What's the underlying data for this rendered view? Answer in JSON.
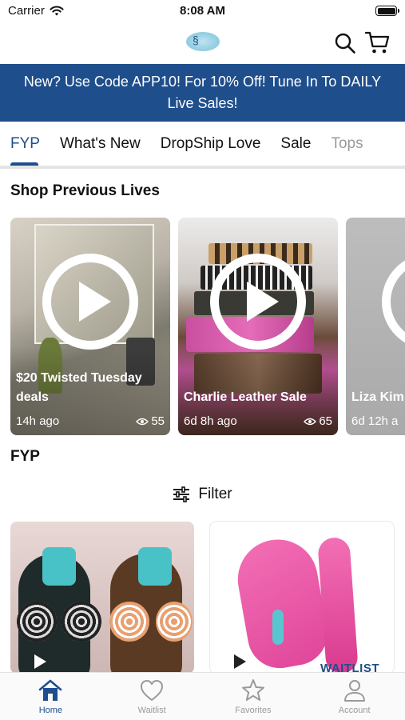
{
  "status_bar": {
    "carrier": "Carrier",
    "time": "8:08 AM"
  },
  "promo": {
    "text": "New? Use Code APP10! For 10% Off! Tune In To DAILY Live Sales!"
  },
  "tabs": [
    {
      "label": "FYP"
    },
    {
      "label": "What's New"
    },
    {
      "label": "DropShip Love"
    },
    {
      "label": "Sale"
    },
    {
      "label": "Tops"
    }
  ],
  "sections": {
    "previous_lives": "Shop Previous Lives",
    "fyp": "FYP"
  },
  "lives": [
    {
      "title": "$20 Twisted Tuesday deals",
      "time": "14h ago",
      "views": "55"
    },
    {
      "title": "Charlie Leather Sale",
      "time": "6d 8h ago",
      "views": "65"
    },
    {
      "title": "Liza Kim",
      "time": "6d 12h a",
      "views": ""
    }
  ],
  "filter": {
    "label": "Filter"
  },
  "products": [
    {
      "tag": ""
    },
    {
      "tag": "WAITLIST"
    }
  ],
  "bottom_nav": [
    {
      "label": "Home",
      "icon": "home-icon"
    },
    {
      "label": "Waitlist",
      "icon": "heart-icon"
    },
    {
      "label": "Favorites",
      "icon": "star-icon"
    },
    {
      "label": "Account",
      "icon": "person-icon"
    }
  ],
  "colors": {
    "brand": "#1f4e8c",
    "inactive": "#9a9a9a",
    "banner_text": "#ffffff"
  }
}
